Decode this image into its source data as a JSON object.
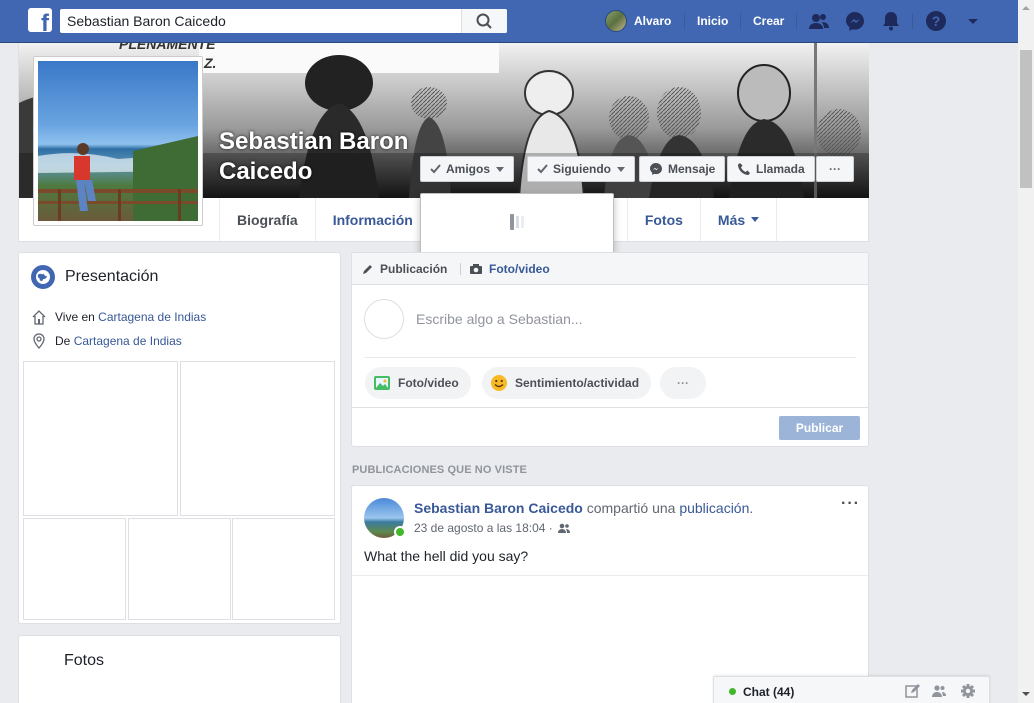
{
  "topbar": {
    "search_value": "Sebastian Baron Caicedo",
    "logo_letter": "f",
    "user_name": "Alvaro",
    "home_label": "Inicio",
    "create_label": "Crear",
    "icons": [
      "friends-icon",
      "messenger-icon",
      "notifications-icon",
      "help-icon",
      "chevron-down-icon"
    ],
    "brand_color": "#4267b2"
  },
  "profile": {
    "name": "Sebastian Baron Caicedo",
    "buttons": {
      "friends": "Amigos",
      "following": "Siguiendo",
      "message": "Mensaje",
      "call": "Llamada",
      "more": "···"
    },
    "tabs": [
      "Biografía",
      "Información",
      "Fotos",
      "Más"
    ]
  },
  "intro": {
    "title": "Presentación",
    "lives_prefix": "Vive en",
    "lives_city": "Cartagena de Indias",
    "from_prefix": "De",
    "from_city": "Cartagena de Indias"
  },
  "photos_card": {
    "title": "Fotos"
  },
  "composer": {
    "tab_post": "Publicación",
    "tab_photo": "Foto/video",
    "placeholder": "Escribe algo a Sebastian...",
    "btn_photo": "Foto/video",
    "btn_feeling": "Sentimiento/actividad",
    "btn_more": "···",
    "publish": "Publicar"
  },
  "section_label": "PUBLICACIONES QUE NO VISTE",
  "post": {
    "author": "Sebastian Baron Caicedo",
    "action_mid": "compartió una",
    "action_link": "publicación",
    "action_end": ".",
    "timestamp": "23 de agosto a las 18:04 ·",
    "text": "What the hell did you say?",
    "more": "···"
  },
  "chat": {
    "label": "Chat (44)"
  }
}
